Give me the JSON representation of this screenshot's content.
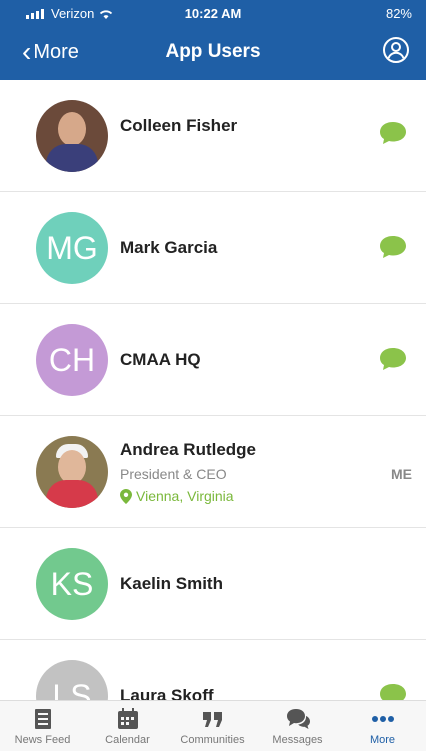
{
  "status_bar": {
    "carrier": "Verizon",
    "time": "10:22 AM",
    "battery": "82%"
  },
  "nav": {
    "back_label": "More",
    "title": "App Users"
  },
  "users": [
    {
      "initials": "",
      "name": "Colleen Fisher",
      "subtitle": "",
      "location": "",
      "has_photo": true,
      "avatar_color": "#6b4a3a",
      "action": "chat"
    },
    {
      "initials": "MG",
      "name": "Mark Garcia",
      "subtitle": "",
      "location": "",
      "has_photo": false,
      "avatar_color": "#6fd0bb",
      "action": "chat"
    },
    {
      "initials": "CH",
      "name": "CMAA HQ",
      "subtitle": "",
      "location": "",
      "has_photo": false,
      "avatar_color": "#c49ad6",
      "action": "chat"
    },
    {
      "initials": "",
      "name": "Andrea Rutledge",
      "subtitle": "President & CEO",
      "location": "Vienna, Virginia",
      "has_photo": true,
      "avatar_color": "#8a7a52",
      "action": "me",
      "badge": "ME"
    },
    {
      "initials": "KS",
      "name": "Kaelin Smith",
      "subtitle": "",
      "location": "",
      "has_photo": false,
      "avatar_color": "#72c98e",
      "action": "none"
    },
    {
      "initials": "LS",
      "name": "Laura Skoff",
      "subtitle": "",
      "location": "",
      "has_photo": false,
      "avatar_color": "#c2c2c2",
      "action": "chat"
    }
  ],
  "tabbar": {
    "tabs": [
      {
        "label": "News Feed",
        "icon": "news-feed-icon",
        "active": false
      },
      {
        "label": "Calendar",
        "icon": "calendar-icon",
        "active": false
      },
      {
        "label": "Communities",
        "icon": "communities-icon",
        "active": false
      },
      {
        "label": "Messages",
        "icon": "messages-icon",
        "active": false
      },
      {
        "label": "More",
        "icon": "more-icon",
        "active": true
      }
    ]
  },
  "colors": {
    "header": "#1f5fa6",
    "accent_green": "#7ab83b",
    "chat_icon": "#8bc34a"
  }
}
